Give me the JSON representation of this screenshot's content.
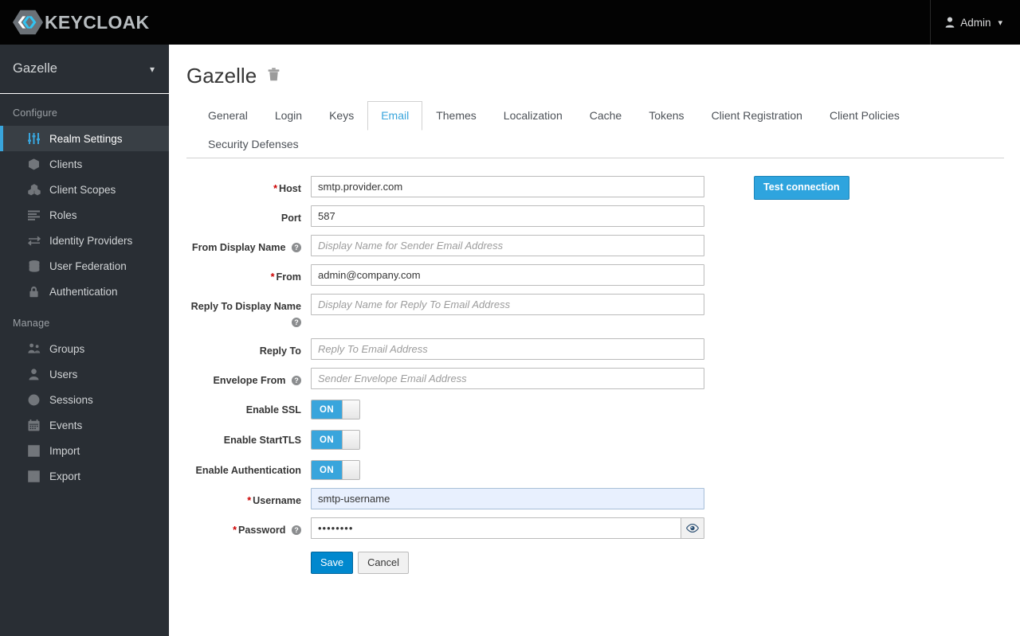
{
  "topbar": {
    "brand_name": "KEYCLOAK",
    "brand_logo_icon": "keycloak-hexagon-logo",
    "user_icon": "user-icon",
    "user_label": "Admin",
    "chevron": "⌄"
  },
  "sidebar": {
    "realm": {
      "name": "Gazelle",
      "chevron_icon": "chevron-down-icon"
    },
    "sections": [
      {
        "title": "Configure",
        "items": [
          {
            "label": "Realm Settings",
            "icon": "sliders-icon",
            "active": true
          },
          {
            "label": "Clients",
            "icon": "cube-icon",
            "active": false
          },
          {
            "label": "Client Scopes",
            "icon": "cubes-icon",
            "active": false
          },
          {
            "label": "Roles",
            "icon": "list-icon",
            "active": false
          },
          {
            "label": "Identity Providers",
            "icon": "exchange-arrows-icon",
            "active": false
          },
          {
            "label": "User Federation",
            "icon": "database-icon",
            "active": false
          },
          {
            "label": "Authentication",
            "icon": "lock-icon",
            "active": false
          }
        ]
      },
      {
        "title": "Manage",
        "items": [
          {
            "label": "Groups",
            "icon": "users-group-icon",
            "active": false
          },
          {
            "label": "Users",
            "icon": "user-icon",
            "active": false
          },
          {
            "label": "Sessions",
            "icon": "clock-icon",
            "active": false
          },
          {
            "label": "Events",
            "icon": "calendar-icon",
            "active": false
          },
          {
            "label": "Import",
            "icon": "import-arrow-icon",
            "active": false
          },
          {
            "label": "Export",
            "icon": "export-arrow-icon",
            "active": false
          }
        ]
      }
    ]
  },
  "page": {
    "title": "Gazelle",
    "delete_icon": "trash-icon",
    "tabs": [
      {
        "label": "General",
        "active": false
      },
      {
        "label": "Login",
        "active": false
      },
      {
        "label": "Keys",
        "active": false
      },
      {
        "label": "Email",
        "active": true
      },
      {
        "label": "Themes",
        "active": false
      },
      {
        "label": "Localization",
        "active": false
      },
      {
        "label": "Cache",
        "active": false
      },
      {
        "label": "Tokens",
        "active": false
      },
      {
        "label": "Client Registration",
        "active": false
      },
      {
        "label": "Client Policies",
        "active": false
      },
      {
        "label": "Security Defenses",
        "active": false
      }
    ]
  },
  "form": {
    "host": {
      "label": "Host",
      "required": true,
      "value": "smtp.provider.com",
      "placeholder": ""
    },
    "port": {
      "label": "Port",
      "required": false,
      "value": "587",
      "placeholder": ""
    },
    "from_display_name": {
      "label": "From Display Name",
      "required": false,
      "has_help": true,
      "value": "",
      "placeholder": "Display Name for Sender Email Address"
    },
    "from": {
      "label": "From",
      "required": true,
      "value": "admin@company.com",
      "placeholder": ""
    },
    "reply_to_display_name": {
      "label": "Reply To Display Name",
      "required": false,
      "has_help": true,
      "value": "",
      "placeholder": "Display Name for Reply To Email Address"
    },
    "reply_to": {
      "label": "Reply To",
      "required": false,
      "value": "",
      "placeholder": "Reply To Email Address"
    },
    "envelope_from": {
      "label": "Envelope From",
      "required": false,
      "has_help": true,
      "value": "",
      "placeholder": "Sender Envelope Email Address"
    },
    "enable_ssl": {
      "label": "Enable SSL",
      "state": "ON"
    },
    "enable_starttls": {
      "label": "Enable StartTLS",
      "state": "ON"
    },
    "enable_authentication": {
      "label": "Enable Authentication",
      "state": "ON"
    },
    "username": {
      "label": "Username",
      "required": true,
      "value": "smtp-username",
      "placeholder": ""
    },
    "password": {
      "label": "Password",
      "required": true,
      "has_help": true,
      "value": "••••••••",
      "placeholder": "",
      "reveal_icon": "eye-icon"
    },
    "save_label": "Save",
    "cancel_label": "Cancel",
    "test_connection_label": "Test connection"
  },
  "colors": {
    "topbar_bg": "#030303",
    "sidebar_bg": "#292e34",
    "accent_blue": "#39a5dc",
    "primary_button": "#0088ce",
    "required_red": "#cc0000",
    "active_nav_bg": "#393f45"
  }
}
